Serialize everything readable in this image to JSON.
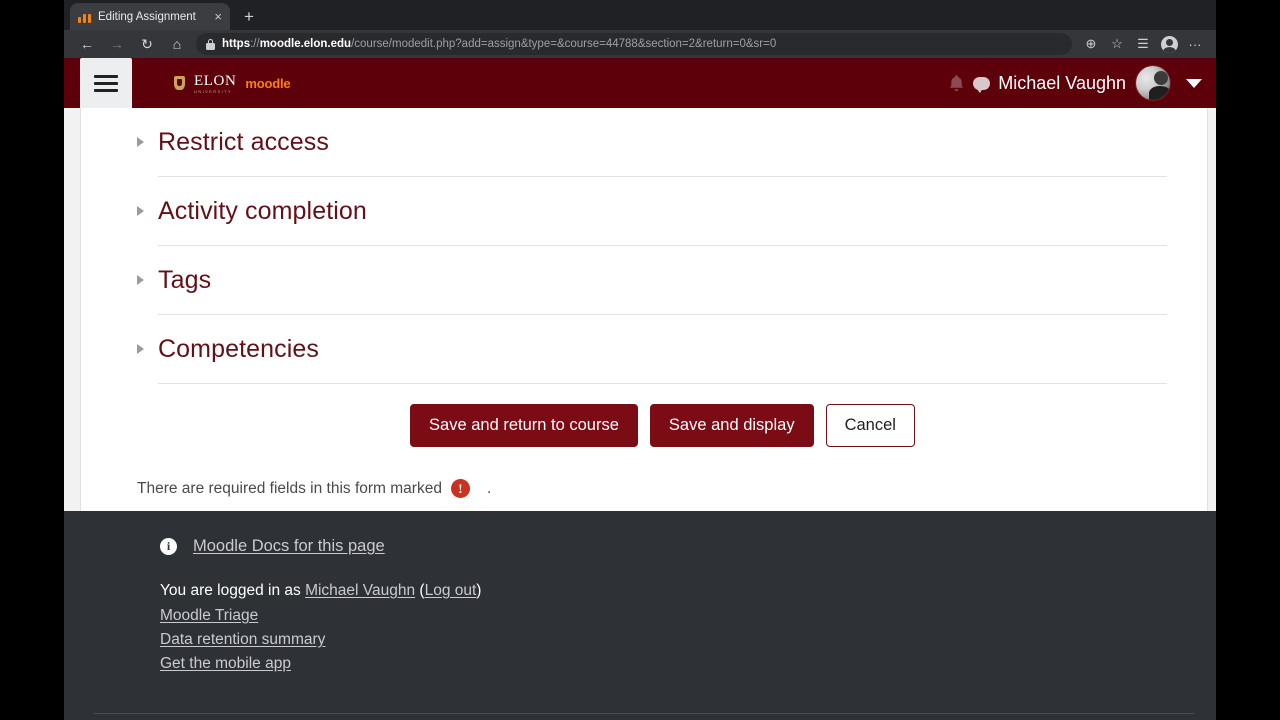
{
  "browser": {
    "tab": {
      "title": "Editing Assignment",
      "favicon": "moodle-logo-icon",
      "close": "×"
    },
    "new_tab": "+",
    "nav": {
      "back": "←",
      "forward": "→",
      "reload": "↻",
      "home": "⌂"
    },
    "omnibox": {
      "lock": "lock-icon",
      "scheme": "https",
      "separator": "://",
      "host": "moodle.elon.edu",
      "path": "/course/modedit.php?add=assign&type=&course=44788&section=2&return=0&sr=0"
    },
    "toolbar_icons": {
      "zoom": "⊕",
      "favorite": "☆",
      "collections": "☰",
      "profile": "profile-avatar-icon",
      "settings": "···"
    }
  },
  "moodle_header": {
    "menu_toggle": "hamburger-menu-icon",
    "brand": {
      "university": "ELON",
      "university_sub": "UNIVERSITY",
      "product": "moodle"
    },
    "notifications_icon": "bell-icon",
    "messages_icon": "message-bubble-icon",
    "user_name": "Michael Vaughn",
    "avatar": "user-avatar",
    "dropdown": "▼"
  },
  "form": {
    "sections": [
      {
        "label": "Restrict access"
      },
      {
        "label": "Activity completion"
      },
      {
        "label": "Tags"
      },
      {
        "label": "Competencies"
      }
    ],
    "buttons": [
      {
        "label": "Save and return to course",
        "style": "primary"
      },
      {
        "label": "Save and display",
        "style": "primary"
      },
      {
        "label": "Cancel",
        "style": "outline"
      }
    ],
    "required_note": {
      "text": "There are required fields in this form marked",
      "badge": "!",
      "trailing": "."
    }
  },
  "footer": {
    "docs_icon": "info-icon",
    "docs_link": "Moodle Docs for this page",
    "logged_in_prefix": "You are logged in as",
    "logged_in_user": "Michael Vaughn",
    "logout": "Log out",
    "paren_open": "(",
    "paren_close": ")",
    "links": [
      "Moodle Triage",
      "Data retention summary",
      "Get the mobile app"
    ]
  },
  "colors": {
    "brand_maroon": "#5e0009",
    "button_maroon": "#7b0b14",
    "heading_maroon": "#631119",
    "moodle_orange": "#f98012",
    "footer_dark": "#2e3136",
    "required_red": "#ca3120"
  }
}
